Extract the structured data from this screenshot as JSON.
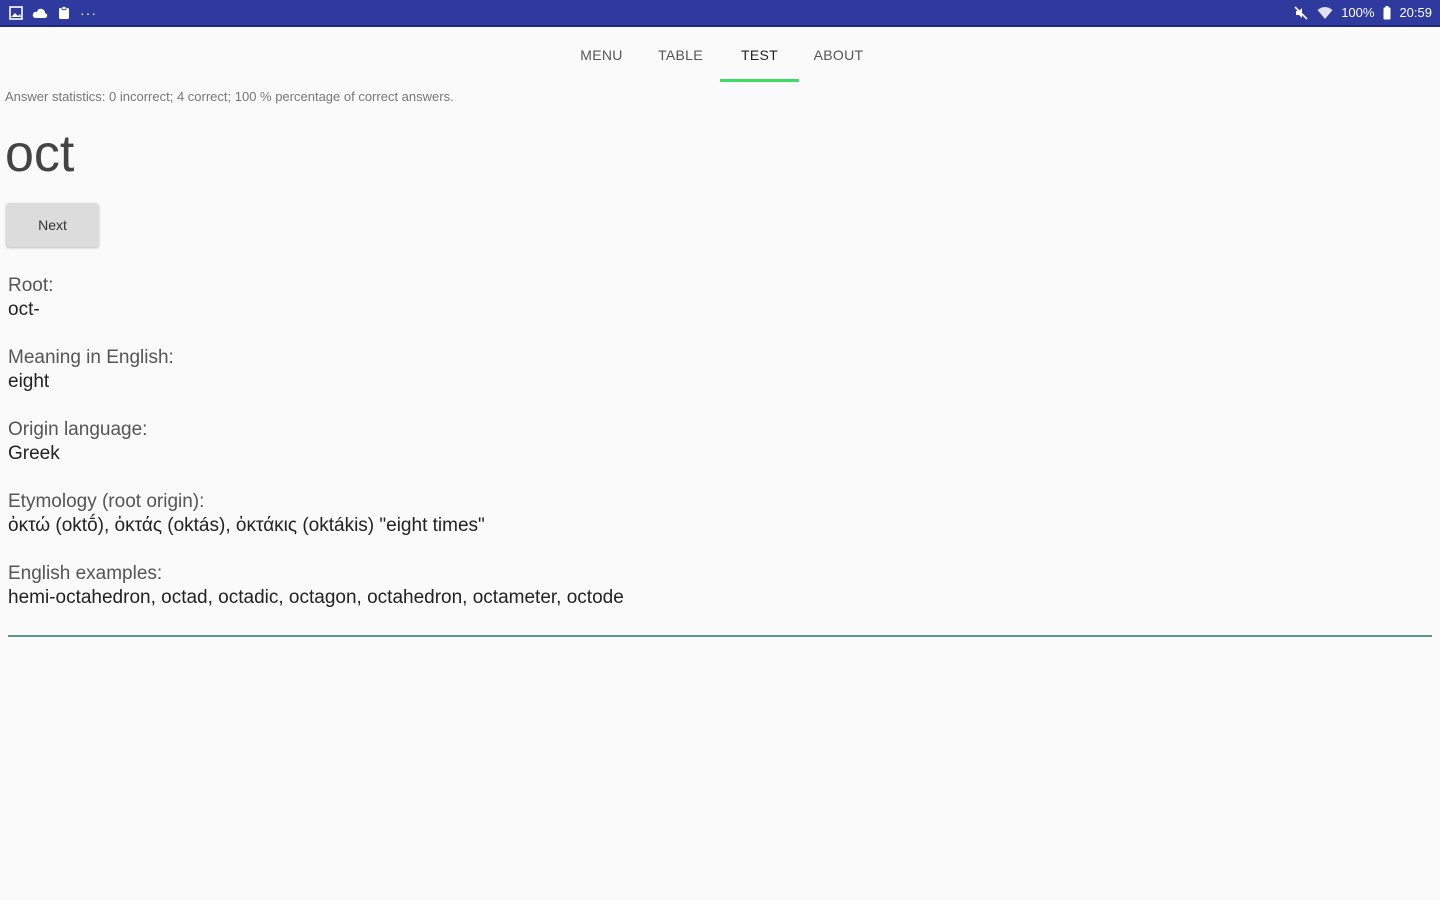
{
  "status_bar": {
    "left_icons": [
      "gallery-icon",
      "cloud-icon",
      "clipboard-icon",
      "more-dots-icon"
    ],
    "more_label": "···",
    "mute_icon": "mute-icon",
    "wifi_icon": "wifi-icon",
    "battery_text": "100%",
    "battery_icon": "battery-icon",
    "time": "20:59"
  },
  "tabs": [
    {
      "label": "MENU",
      "active": false
    },
    {
      "label": "TABLE",
      "active": false
    },
    {
      "label": "TEST",
      "active": true
    },
    {
      "label": "ABOUT",
      "active": false
    }
  ],
  "accent_color": "#3ddc68",
  "statusbar_color": "#2e3a9e",
  "stats_text": "Answer statistics: 0 incorrect; 4 correct; 100 % percentage of correct answers.",
  "word": "oct",
  "next_label": "Next",
  "details": {
    "root_label": "Root:",
    "root_value": "oct-",
    "meaning_label": "Meaning in English:",
    "meaning_value": "eight",
    "origin_label": "Origin language:",
    "origin_value": "Greek",
    "etymology_label": "Etymology (root origin):",
    "etymology_value": "ὀκτώ (oktṓ), ὀκτάς (oktás), ὀκτάκις (oktákis) \"eight times\"",
    "examples_label": "English examples:",
    "examples_value": "hemi-octahedron, octad, octadic, octagon, octahedron, octameter, octode"
  }
}
